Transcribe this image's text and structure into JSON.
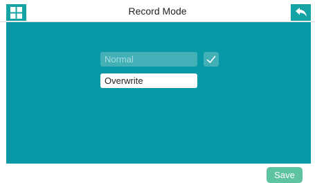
{
  "header": {
    "title": "Record Mode",
    "home_icon": "grid-icon",
    "back_icon": "back-arrow-icon"
  },
  "record_mode": {
    "options": [
      {
        "label": "Normal",
        "selected": true
      },
      {
        "label": "Overwrite",
        "selected": false
      }
    ],
    "check_icon": "checkmark-icon"
  },
  "footer": {
    "save_label": "Save"
  },
  "colors": {
    "accent_teal": "#15a3a6",
    "panel_teal": "#0898a6",
    "selected_option_bg": "#42b0b6",
    "save_button": "#5ec3a3"
  }
}
